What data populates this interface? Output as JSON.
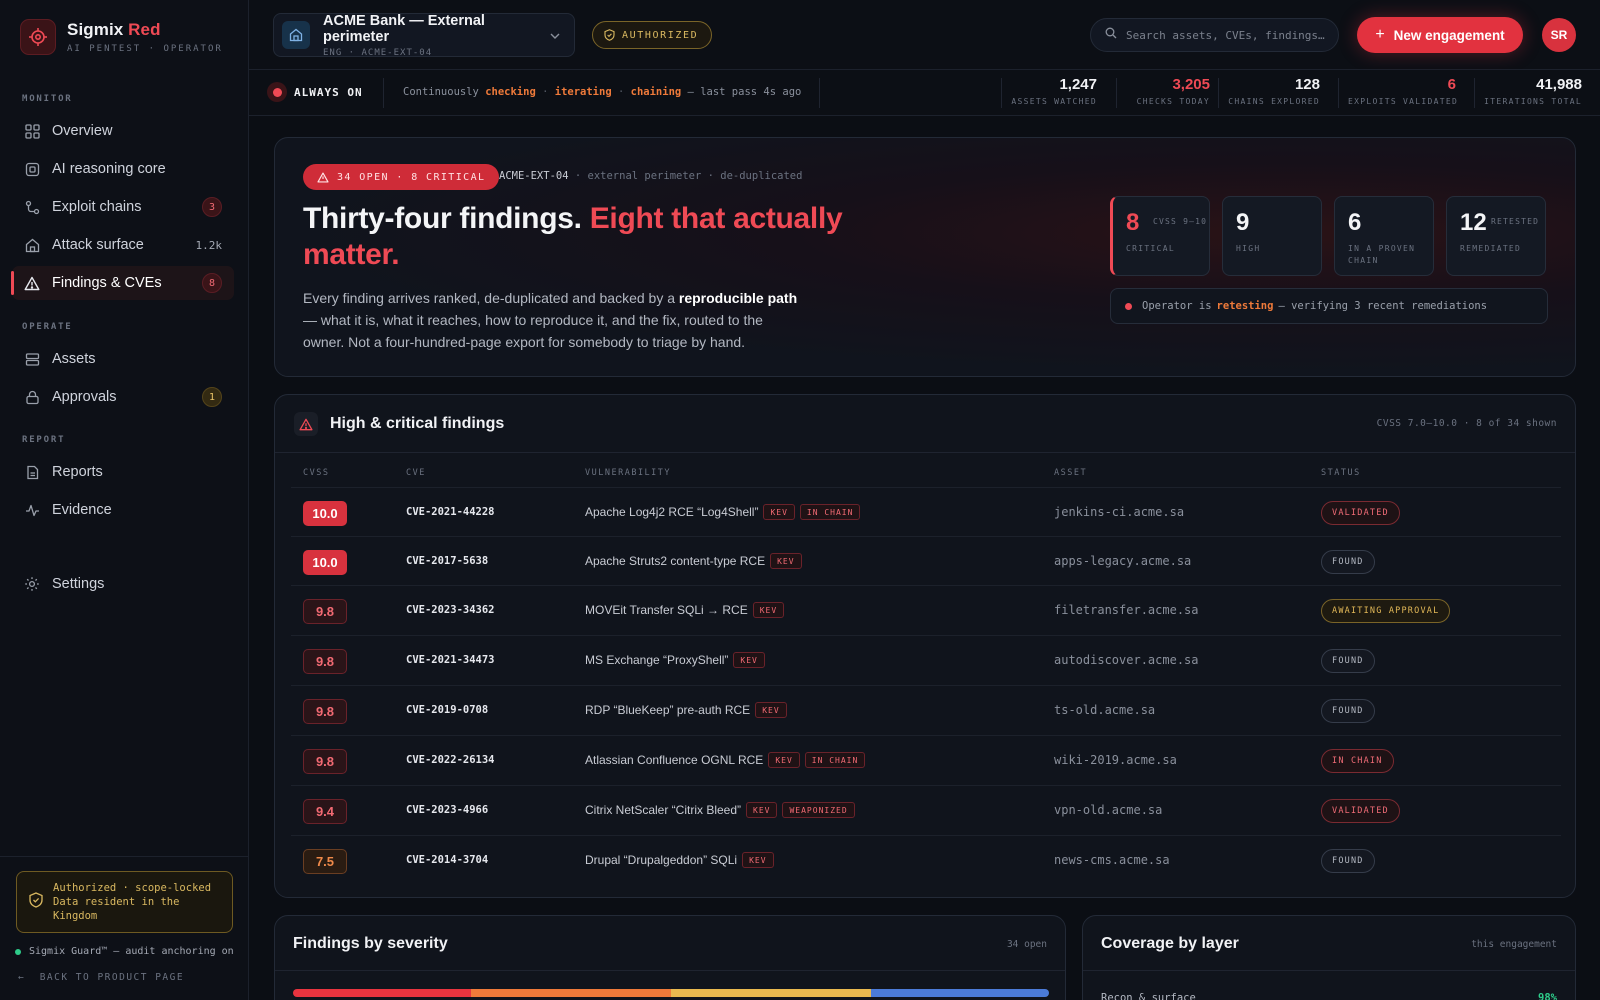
{
  "brand": {
    "name_part1": "Sigmix",
    "name_part2": "Red",
    "subtitle": "AI PENTEST · OPERATOR"
  },
  "sidebar": {
    "sections": [
      {
        "label": "MONITOR"
      },
      {
        "label": "OPERATE"
      },
      {
        "label": "REPORT"
      }
    ],
    "items": [
      {
        "label": "Overview",
        "icon": "grid-icon"
      },
      {
        "label": "AI reasoning core",
        "icon": "chip-icon"
      },
      {
        "label": "Exploit chains",
        "icon": "chain-icon",
        "badge": "3"
      },
      {
        "label": "Attack surface",
        "icon": "building-icon",
        "meta": "1.2k"
      },
      {
        "label": "Findings & CVEs",
        "icon": "warning-icon",
        "badge": "8",
        "active": true
      },
      {
        "label": "Assets",
        "icon": "server-icon"
      },
      {
        "label": "Approvals",
        "icon": "lock-icon",
        "badge": "1"
      },
      {
        "label": "Reports",
        "icon": "document-icon"
      },
      {
        "label": "Evidence",
        "icon": "pulse-icon"
      },
      {
        "label": "Settings",
        "icon": "gear-icon"
      }
    ],
    "auth_box": {
      "line1": "Authorized · scope-locked",
      "line2": "Data resident in the",
      "line3": "Kingdom"
    },
    "guard": "Sigmix Guard™ — audit anchoring on",
    "back_link": "BACK TO PRODUCT PAGE"
  },
  "topbar": {
    "engagement_title": "ACME Bank — External perimeter",
    "engagement_sub": "ENG · ACME-EXT-04",
    "authorized": "AUTHORIZED",
    "search_placeholder": "Search assets, CVEs, findings…",
    "new_button": "New engagement",
    "avatar": "SR"
  },
  "status": {
    "always_on": "ALWAYS ON",
    "text_prefix": "Continuously",
    "word1": "checking",
    "word2": "iterating",
    "word3": "chaining",
    "text_suffix": "— last pass 4s ago",
    "metrics": [
      {
        "value": "1,247",
        "label": "ASSETS WATCHED"
      },
      {
        "value": "3,205",
        "label": "CHECKS TODAY",
        "red": true
      },
      {
        "value": "128",
        "label": "CHAINS EXPLORED"
      },
      {
        "value": "6",
        "label": "EXPLOITS VALIDATED",
        "red": true
      },
      {
        "value": "41,988",
        "label": "ITERATIONS TOTAL"
      }
    ]
  },
  "hero": {
    "pill": "34 OPEN · 8 CRITICAL",
    "ctx_id": "ACME-EXT-04",
    "ctx_rest": "· external perimeter · de-duplicated",
    "title_part1": "Thirty-four findings.",
    "title_part2": "Eight that actually matter.",
    "body_part1": "Every finding arrives ranked, de-duplicated and backed by a",
    "body_bold": "reproducible path",
    "body_part2": "— what it is, what it reaches, how to reproduce it, and the fix, routed to the owner. Not a four-hundred-page export for somebody to triage by hand.",
    "cards": [
      {
        "value": "8",
        "tag": "CVSS 9–10",
        "label": "CRITICAL"
      },
      {
        "value": "9",
        "tag": "",
        "label": "HIGH"
      },
      {
        "value": "6",
        "tag": "",
        "label": "IN A PROVEN CHAIN"
      },
      {
        "value": "12",
        "tag": "RETESTED",
        "label": "REMEDIATED"
      }
    ],
    "retest_prefix": "Operator is",
    "retest_word": "retesting",
    "retest_suffix": "— verifying 3 recent remediations"
  },
  "findings": {
    "title": "High & critical findings",
    "meta": "CVSS 7.0–10.0 · 8 of 34 shown",
    "columns": [
      "CVSS",
      "CVE",
      "VULNERABILITY",
      "ASSET",
      "STATUS"
    ],
    "rows": [
      {
        "cvss": "10.0",
        "level": "crit",
        "cve": "CVE-2021-44228",
        "vuln": "Apache Log4j2 RCE “Log4Shell”",
        "tags": [
          "KEV",
          "IN CHAIN"
        ],
        "asset": "jenkins-ci.acme.sa",
        "status": "VALIDATED",
        "status_kind": "validated"
      },
      {
        "cvss": "10.0",
        "level": "crit",
        "cve": "CVE-2017-5638",
        "vuln": "Apache Struts2 content-type RCE",
        "tags": [
          "KEV"
        ],
        "asset": "apps-legacy.acme.sa",
        "status": "FOUND",
        "status_kind": "found"
      },
      {
        "cvss": "9.8",
        "level": "high",
        "cve": "CVE-2023-34362",
        "vuln": "MOVEit Transfer SQLi → RCE",
        "tags": [
          "KEV"
        ],
        "asset": "filetransfer.acme.sa",
        "status": "AWAITING APPROVAL",
        "status_kind": "awaiting"
      },
      {
        "cvss": "9.8",
        "level": "high",
        "cve": "CVE-2021-34473",
        "vuln": "MS Exchange “ProxyShell”",
        "tags": [
          "KEV"
        ],
        "asset": "autodiscover.acme.sa",
        "status": "FOUND",
        "status_kind": "found"
      },
      {
        "cvss": "9.8",
        "level": "high",
        "cve": "CVE-2019-0708",
        "vuln": "RDP “BlueKeep” pre-auth RCE",
        "tags": [
          "KEV"
        ],
        "asset": "ts-old.acme.sa",
        "status": "FOUND",
        "status_kind": "found"
      },
      {
        "cvss": "9.8",
        "level": "high",
        "cve": "CVE-2022-26134",
        "vuln": "Atlassian Confluence OGNL RCE",
        "tags": [
          "KEV",
          "IN CHAIN"
        ],
        "asset": "wiki-2019.acme.sa",
        "status": "IN CHAIN",
        "status_kind": "chain"
      },
      {
        "cvss": "9.4",
        "level": "high",
        "cve": "CVE-2023-4966",
        "vuln": "Citrix NetScaler “Citrix Bleed”",
        "tags": [
          "KEV",
          "WEAPONIZED"
        ],
        "asset": "vpn-old.acme.sa",
        "status": "VALIDATED",
        "status_kind": "validated"
      },
      {
        "cvss": "7.5",
        "level": "med",
        "cve": "CVE-2014-3704",
        "vuln": "Drupal “Drupalgeddon” SQLi",
        "tags": [
          "KEV"
        ],
        "asset": "news-cms.acme.sa",
        "status": "FOUND",
        "status_kind": "found"
      }
    ]
  },
  "severity_panel": {
    "title": "Findings by severity",
    "meta": "34 open",
    "segments": [
      {
        "fraction": 0.235,
        "color": "#e8343f"
      },
      {
        "fraction": 0.265,
        "color": "#ef7a3a"
      },
      {
        "fraction": 0.265,
        "color": "#e9b94f"
      },
      {
        "fraction": 0.235,
        "color": "#4b7bd8"
      }
    ]
  },
  "coverage_panel": {
    "title": "Coverage by layer",
    "meta": "this engagement",
    "row_label": "Recon & surface",
    "row_value": "98%"
  },
  "colors": {
    "accent": "#ef4a55",
    "amber": "#d9b860",
    "success": "#2ecc8a"
  }
}
